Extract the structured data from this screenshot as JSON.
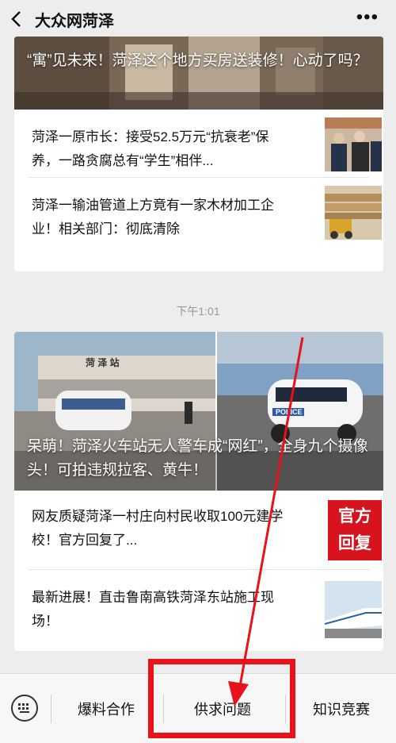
{
  "header": {
    "title": "大众网菏泽"
  },
  "card1": {
    "hero_title": "“寓”见未来！菏泽这个地方买房送装修！心动了吗？",
    "items": [
      {
        "text": "菏泽一原市长：接受52.5万元“抗衰老”保养，一路贪腐总有“学生”相伴..."
      },
      {
        "text": "菏泽一输油管道上方竟有一家木材加工企业！相关部门：彻底清除"
      }
    ]
  },
  "timestamp": "下午1:01",
  "card2": {
    "hero_title": "呆萌！菏泽火车站无人警车成“网红”，全身九个摄像头！可拍违规拉客、黄牛！",
    "station_sign": "菏 泽 站",
    "police_label": "POLICE",
    "items": [
      {
        "text": "网友质疑菏泽一村庄向村民收取100元建学校！官方回复了...",
        "badge": [
          "官方",
          "回复"
        ]
      },
      {
        "text": "最新进展！直击鲁南高铁菏泽东站施工现场！"
      }
    ]
  },
  "bottom_menu": {
    "items": [
      "爆料合作",
      "供求问题",
      "知识竞赛"
    ]
  },
  "colors": {
    "annotation": "#e8121a",
    "badge": "#d7141d"
  }
}
